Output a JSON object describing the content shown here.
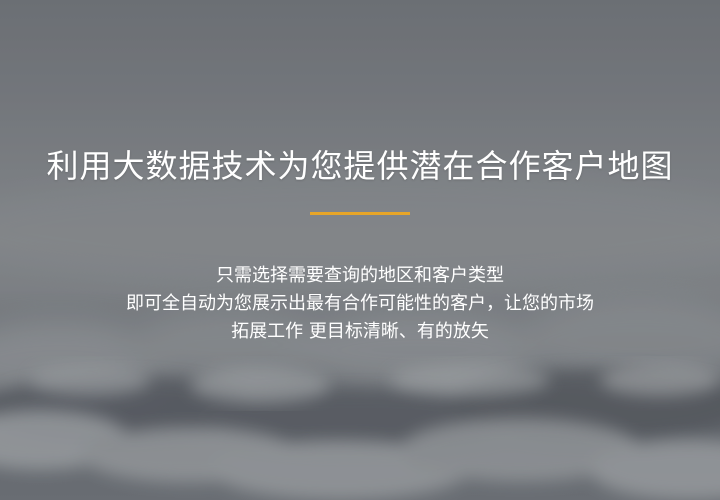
{
  "hero": {
    "title": "利用大数据技术为您提供潜在合作客户地图",
    "accent_color": "#e7a528",
    "description_lines": [
      "只需选择需要查询的地区和客户类型",
      "即可全自动为您展示出最有合作可能性的客户，让您的市场",
      "拓展工作 更目标清晰、有的放矢"
    ]
  }
}
